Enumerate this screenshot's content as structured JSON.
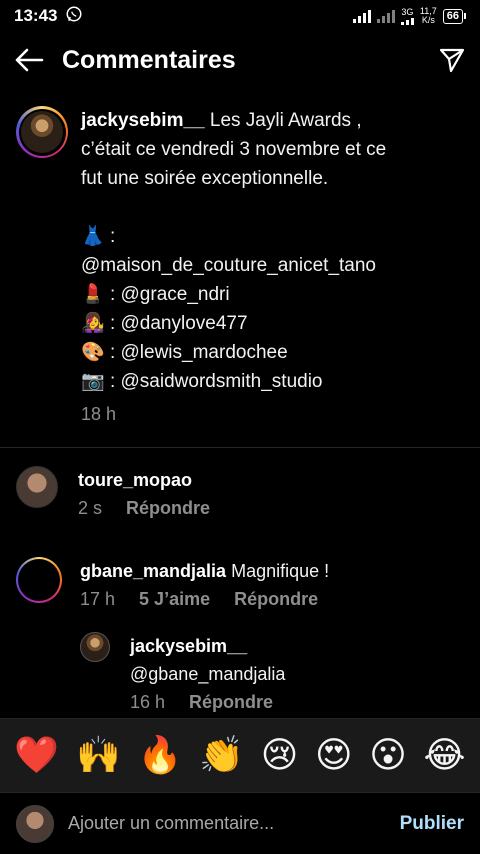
{
  "status_bar": {
    "time": "13:43",
    "whatsapp_icon": "whatsapp-icon",
    "network_type": "3G",
    "speed_value": "11,7",
    "speed_unit": "K/s",
    "battery": "66"
  },
  "header": {
    "title": "Commentaires",
    "back_icon": "back-arrow-icon",
    "share_icon": "send-icon"
  },
  "post": {
    "username": "jackysebim__",
    "caption_line1": "Les Jayli Awards ,",
    "caption_line2": "c’était ce vendredi 3 novembre et ce",
    "caption_line3": "fut une soirée exceptionnelle.",
    "credits": [
      {
        "emoji": "👗",
        "text": ":"
      },
      {
        "emoji": "",
        "text": "@maison_de_couture_anicet_tano"
      },
      {
        "emoji": "💄",
        "text": ": @grace_ndri"
      },
      {
        "emoji": "👩‍🎤",
        "text": ": @danylove477"
      },
      {
        "emoji": "🎨",
        "text": ": @lewis_mardochee"
      },
      {
        "emoji": "📷",
        "text": ": @saidwordsmith_studio"
      }
    ],
    "time": "18 h"
  },
  "comments": [
    {
      "username": "toure_mopao",
      "text": "",
      "time": "2 s",
      "likes": "",
      "reply": "Répondre"
    },
    {
      "username": "gbane_mandjalia",
      "text": "Magnifique !",
      "time": "17 h",
      "likes": "5 J’aime",
      "reply": "Répondre"
    }
  ],
  "reply": {
    "username": "jackysebim__",
    "text": "@gbane_mandjalia",
    "time": "16 h",
    "reply": "Répondre"
  },
  "emoji_bar": [
    "❤️",
    "🙌",
    "🔥",
    "👏",
    "😢",
    "😍",
    "😮",
    "😂"
  ],
  "composer": {
    "placeholder": "Ajouter un commentaire...",
    "publish": "Publier"
  }
}
